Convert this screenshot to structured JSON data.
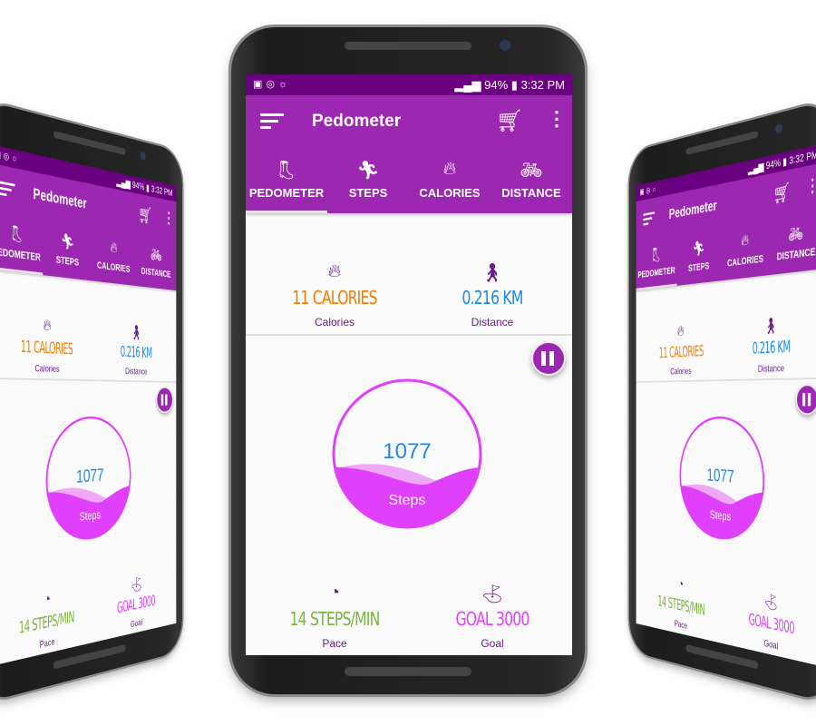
{
  "status_bar": {
    "left_icons": [
      "image-icon",
      "sync-icon",
      "weather-icon"
    ],
    "battery": "94%",
    "time": "3:32 PM"
  },
  "toolbar": {
    "title": "Pedometer",
    "menu_icon": "sort-menu-icon",
    "cart_icon": "cart-icon",
    "more_icon": "more-vert-icon"
  },
  "tabs": [
    {
      "label": "PEDOMETER",
      "icon": "boot-icon",
      "active": true
    },
    {
      "label": "STEPS",
      "icon": "run-icon",
      "active": false
    },
    {
      "label": "CALORIES",
      "icon": "flame-icon",
      "active": false
    },
    {
      "label": "DISTANCE",
      "icon": "bike-icon",
      "active": false
    }
  ],
  "stats_top": [
    {
      "value": "11 CALORIES",
      "label": "Calories",
      "color": "#f57c00",
      "icon": "flame-icon"
    },
    {
      "value": "0.216 KM",
      "label": "Distance",
      "color": "#1e88e5",
      "icon": "walker-icon"
    }
  ],
  "gauge": {
    "steps": "1077",
    "label": "Steps",
    "progress_percent": 36,
    "color": "#e040fb"
  },
  "stats_bottom": [
    {
      "value": "14 STEPS/MIN",
      "label": "Pace",
      "color": "#7cb342",
      "icon": "speedometer-icon"
    },
    {
      "value": "GOAL 3000",
      "label": "Goal",
      "color": "#e040fb",
      "icon": "golf-flag-icon"
    }
  ],
  "colors": {
    "primary": "#9c27b0",
    "primary_dark": "#6a0080"
  }
}
